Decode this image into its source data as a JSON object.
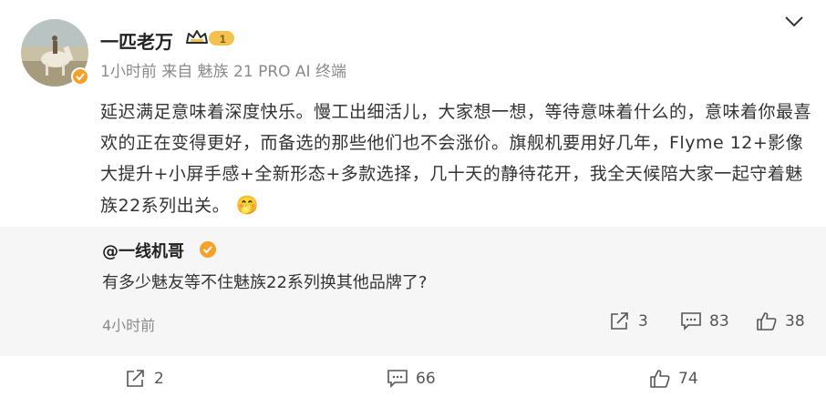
{
  "post": {
    "author": "一匹老万",
    "level_badge": "1",
    "meta": "1小时前 来自 魅族 21 PRO AI 终端",
    "content": "延迟满足意味着深度快乐。慢工出细活儿，大家想一想，等待意味着什么的，意味着你最喜欢的正在变得更好，而备选的那些他们也不会涨价。旗舰机要用好几年，Flyme 12+影像大提升+小屏手感+全新形态+多款选择，几十天的静待花开，我全天候陪大家一起守着魅族22系列出关。",
    "emoji": "🤭",
    "actions": {
      "repost": "2",
      "comment": "66",
      "like": "74"
    }
  },
  "repost": {
    "author": "@一线机哥",
    "text": "有多少魅友等不住魅族22系列换其他品牌了?",
    "time": "4小时前",
    "actions": {
      "repost": "3",
      "comment": "83",
      "like": "38"
    }
  },
  "icons": {
    "more": "chevron-down-icon",
    "repost": "share-icon",
    "comment": "comment-icon",
    "like": "thumbs-up-icon"
  },
  "colors": {
    "verified": "#f6a12a",
    "meta": "#8a8a8a",
    "repost_bg": "#f6f6f6"
  }
}
